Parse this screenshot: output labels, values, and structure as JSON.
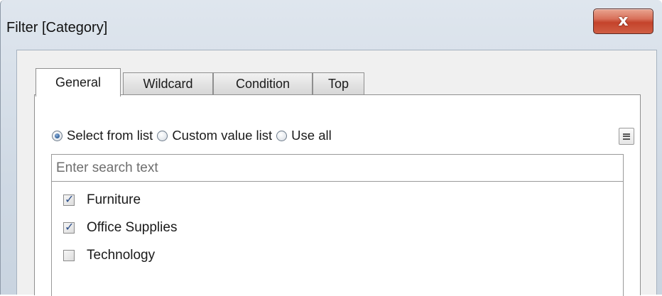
{
  "window": {
    "title": "Filter [Category]",
    "close_glyph": "x"
  },
  "tabs": [
    {
      "label": "General",
      "active": true
    },
    {
      "label": "Wildcard",
      "active": false
    },
    {
      "label": "Condition",
      "active": false
    },
    {
      "label": "Top",
      "active": false
    }
  ],
  "mode": {
    "options": [
      {
        "label": "Select from list",
        "selected": true
      },
      {
        "label": "Custom value list",
        "selected": false
      },
      {
        "label": "Use all",
        "selected": false
      }
    ]
  },
  "search": {
    "placeholder": "Enter search text",
    "value": ""
  },
  "items": [
    {
      "label": "Furniture",
      "checked": true
    },
    {
      "label": "Office Supplies",
      "checked": true
    },
    {
      "label": "Technology",
      "checked": false
    }
  ],
  "icons": {
    "close": "close-icon",
    "menu": "list-menu-icon"
  },
  "colors": {
    "close_button": "#c4432b",
    "checkmark": "#2d4f8a",
    "radio_selected": "#2d5f9a"
  }
}
